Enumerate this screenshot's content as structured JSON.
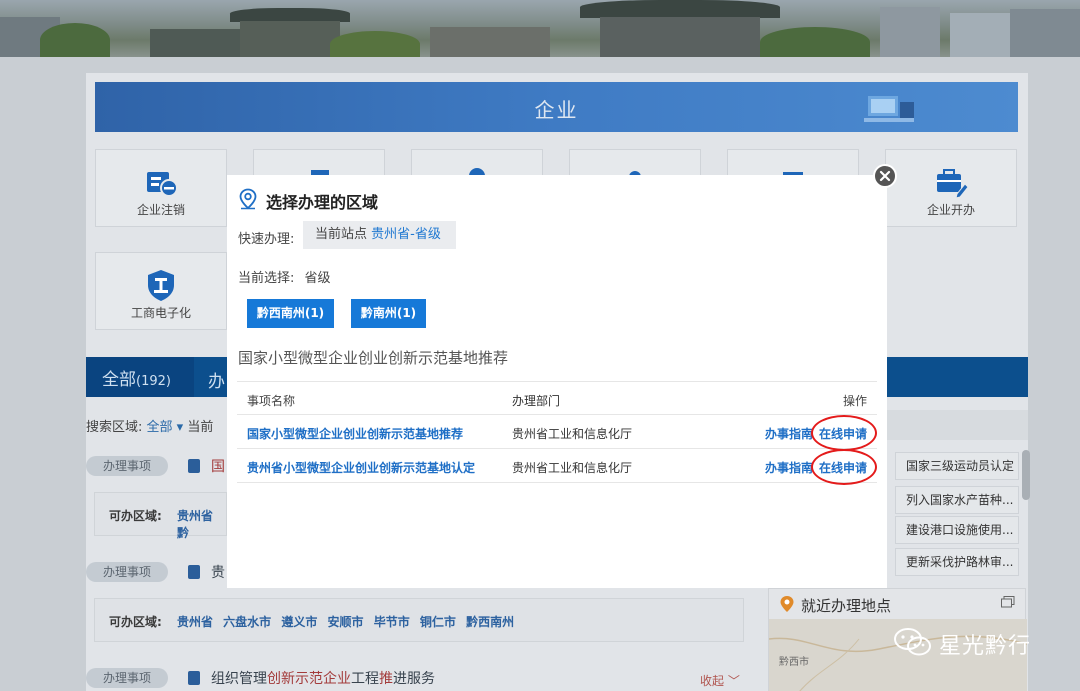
{
  "hero": {
    "title": "企业"
  },
  "tiles": [
    {
      "label": "企业注销",
      "icon": "id-card-minus-icon"
    },
    {
      "label": "",
      "icon": "document-stack-icon"
    },
    {
      "label": "",
      "icon": "person-icon"
    },
    {
      "label": "",
      "icon": "group-icon"
    },
    {
      "label": "",
      "icon": "building-icon"
    },
    {
      "label": "企业开办",
      "icon": "briefcase-edit-icon"
    },
    {
      "label": "工商电子化",
      "icon": "shield-work-icon"
    }
  ],
  "tabs": {
    "all_label": "全部",
    "all_count": "(192)",
    "next_label": "办"
  },
  "search": {
    "label": "搜索区域:",
    "value": "全部 ▾",
    "current": "当前"
  },
  "rows": [
    {
      "tag": "办理事项",
      "title": "国",
      "region_label": "可办区域:",
      "regions": "贵州省 黔"
    },
    {
      "tag": "办理事项",
      "title": "贵",
      "region_label": "可办区域:",
      "regions": "贵州省 六盘水市 遵义市 安顺市 毕节市 铜仁市 黔西南州"
    },
    {
      "tag": "办理事项",
      "title_pre": "组织管理",
      "title_red1": "创新示范企业",
      "title_mid": "工程",
      "title_red2": "推",
      "title_post": "进服务",
      "collapse": "收起 ﹀"
    }
  ],
  "side_items": [
    "国家三级运动员认定",
    "列入国家水产苗种...",
    "建设港口设施使用...",
    "更新采伐护路林审..."
  ],
  "nearby": {
    "title": "就近办理地点",
    "map_label": "黔西市"
  },
  "watermark": {
    "text": "星光黔行"
  },
  "modal": {
    "title": "选择办理的区域",
    "quick_label": "快速办理:",
    "site_prefix": "当前站点",
    "site_value": "贵州省-省级",
    "current_label": "当前选择:",
    "current_value": "省级",
    "buttons": [
      "黔西南州(1)",
      "黔南州(1)"
    ],
    "section": "国家小型微型企业创业创新示范基地推荐",
    "table": {
      "headers": [
        "事项名称",
        "办理部门",
        "操作"
      ],
      "rows": [
        {
          "name": "国家小型微型企业创业创新示范基地推荐",
          "dept": "贵州省工业和信息化厅",
          "guide": "办事指南",
          "apply": "在线申请"
        },
        {
          "name": "贵州省小型微型企业创业创新示范基地认定",
          "dept": "贵州省工业和信息化厅",
          "guide": "办事指南",
          "apply": "在线申请"
        }
      ]
    }
  },
  "colors": {
    "primary": "#1679d8",
    "link": "#1f6fc6",
    "highlight": "#e41b1b"
  }
}
